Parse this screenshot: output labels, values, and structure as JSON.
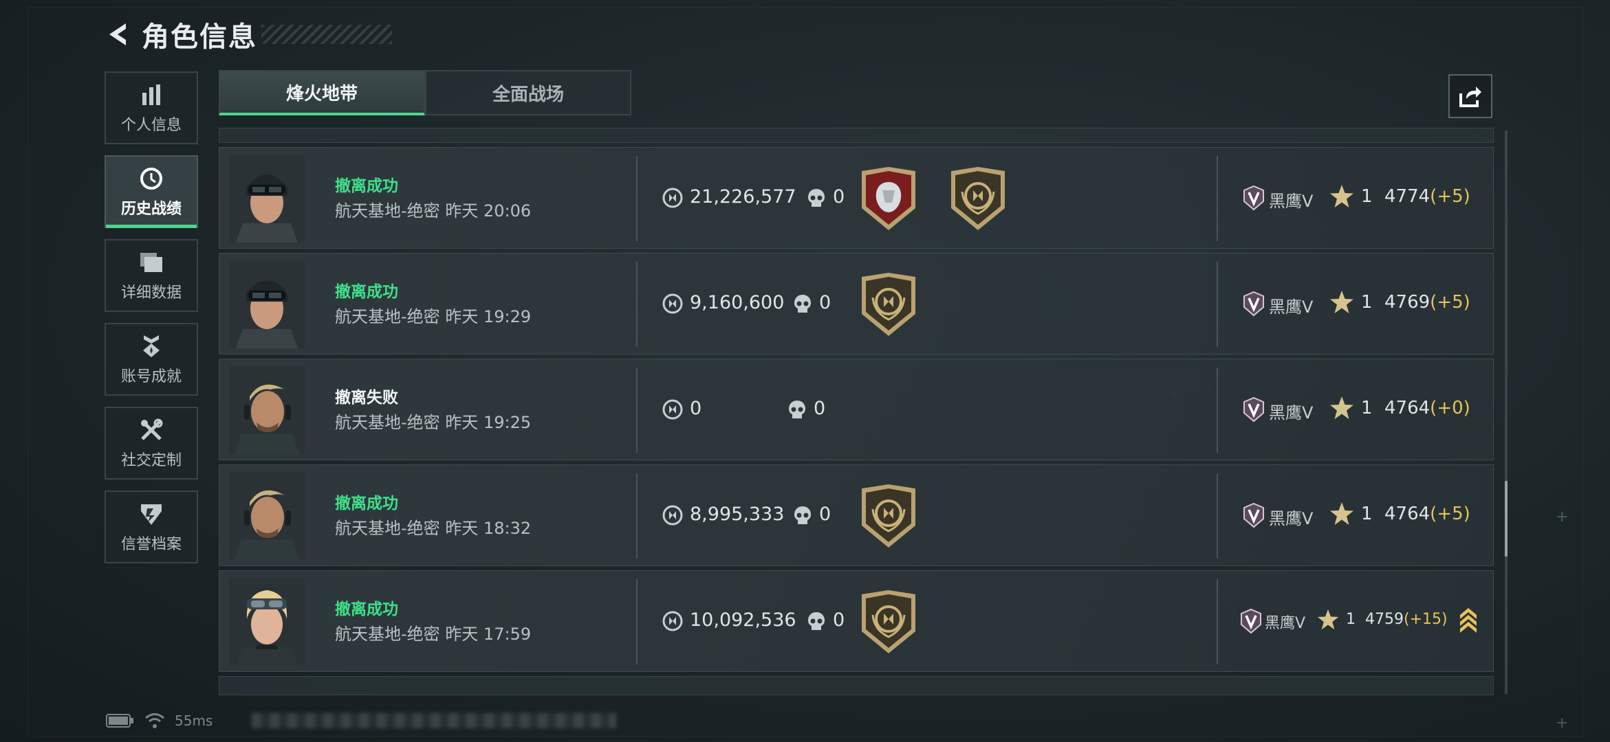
{
  "header": {
    "title": "角色信息"
  },
  "sidebar": {
    "items": [
      {
        "label": "个人信息",
        "icon": "bar-chart-icon",
        "active": false
      },
      {
        "label": "历史战绩",
        "icon": "history-clock-icon",
        "active": true
      },
      {
        "label": "详细数据",
        "icon": "folder-icon",
        "active": false
      },
      {
        "label": "账号成就",
        "icon": "achievement-icon",
        "active": false
      },
      {
        "label": "社交定制",
        "icon": "tools-icon",
        "active": false
      },
      {
        "label": "信誉档案",
        "icon": "shield-emblem-icon",
        "active": false
      }
    ]
  },
  "tabs": [
    {
      "label": "烽火地带",
      "active": true
    },
    {
      "label": "全面战场",
      "active": false
    }
  ],
  "records": [
    {
      "status": "撤离成功",
      "map": "航天基地-绝密",
      "time": "昨天 20:06",
      "value": "21,226,577",
      "kills": "0",
      "medals": [
        "diamond-medal-icon",
        "gold-emblem-medal-icon"
      ],
      "rank": "黑鹰V",
      "level": "1",
      "score": "4774",
      "delta": "(+5)"
    },
    {
      "status": "撤离成功",
      "map": "航天基地-绝密",
      "time": "昨天 19:29",
      "value": "9,160,600",
      "kills": "0",
      "medals": [
        "gold-emblem-medal-icon"
      ],
      "rank": "黑鹰V",
      "level": "1",
      "score": "4769",
      "delta": "(+5)"
    },
    {
      "status": "撤离失败",
      "map": "航天基地-绝密",
      "time": "昨天 19:25",
      "value": "0",
      "kills": "0",
      "medals": [],
      "rank": "黑鹰V",
      "level": "1",
      "score": "4764",
      "delta": "(+0)"
    },
    {
      "status": "撤离成功",
      "map": "航天基地-绝密",
      "time": "昨天 18:32",
      "value": "8,995,333",
      "kills": "0",
      "medals": [
        "gold-emblem-medal-icon"
      ],
      "rank": "黑鹰V",
      "level": "1",
      "score": "4764",
      "delta": "(+5)"
    },
    {
      "status": "撤离成功",
      "map": "航天基地-绝密",
      "time": "昨天 17:59",
      "value": "10,092,536",
      "kills": "0",
      "medals": [
        "gold-emblem-medal-icon"
      ],
      "rank": "黑鹰V",
      "level": "1",
      "score": "4759",
      "delta": "(+15)",
      "promotion": true
    }
  ],
  "footer": {
    "ping": "55ms"
  },
  "colors": {
    "success": "#3ee08a",
    "accent": "#4fd48f",
    "delta": "#e8c35a"
  }
}
